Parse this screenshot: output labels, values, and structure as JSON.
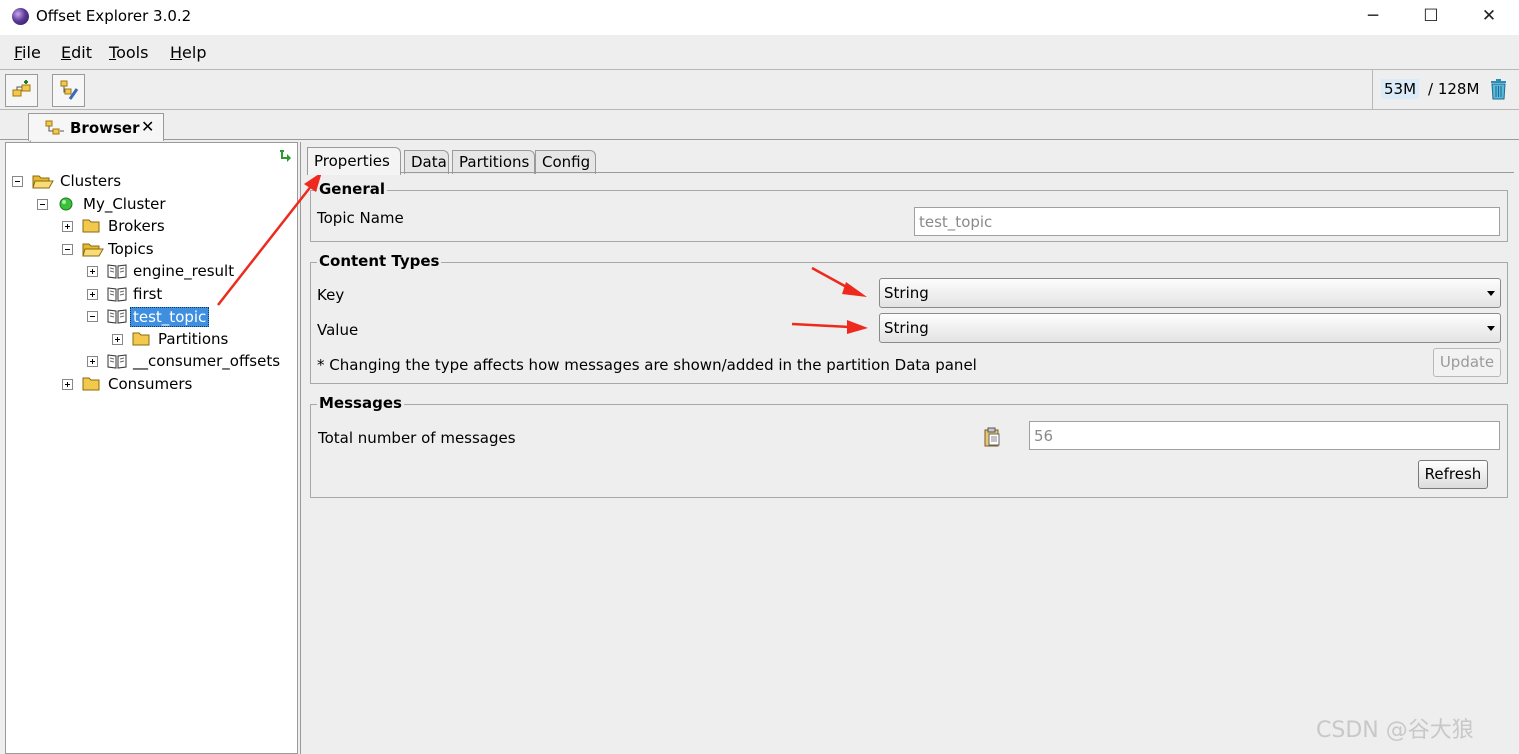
{
  "window": {
    "title": "Offset Explorer  3.0.2",
    "controls": {
      "minimize": "─",
      "maximize": "☐",
      "close": "✕"
    }
  },
  "menu": [
    {
      "label": "File",
      "mnemonic": "F",
      "rest": "ile"
    },
    {
      "label": "Edit",
      "mnemonic": "E",
      "rest": "dit"
    },
    {
      "label": "Tools",
      "mnemonic": "T",
      "rest": "ools"
    },
    {
      "label": "Help",
      "mnemonic": "H",
      "rest": "elp"
    }
  ],
  "toolbar": {
    "memory_used": "53M",
    "memory_total": " / 128M"
  },
  "browser_tab": {
    "label": "Browser",
    "close": "✕"
  },
  "tree": {
    "clusters": "Clusters",
    "cluster": "My_Cluster",
    "brokers": "Brokers",
    "topics": "Topics",
    "topic_items": [
      "engine_result",
      "first",
      "test_topic"
    ],
    "partitions": "Partitions",
    "consumer_offsets": "__consumer_offsets",
    "consumers": "Consumers"
  },
  "tabs": [
    "Properties",
    "Data",
    "Partitions",
    "Config"
  ],
  "general": {
    "title": "General",
    "topic_name_label": "Topic Name",
    "topic_name_value": "test_topic"
  },
  "content_types": {
    "title": "Content Types",
    "key_label": "Key",
    "key_value": "String",
    "value_label": "Value",
    "value_value": "String",
    "note": "* Changing the type affects how messages are shown/added in the partition Data panel",
    "update_button": "Update"
  },
  "messages": {
    "title": "Messages",
    "total_label": "Total number of messages",
    "total_value": "56",
    "refresh_button": "Refresh"
  },
  "watermark": "CSDN @谷大狼",
  "colors": {
    "selection": "#3e8fe0",
    "annotation_arrow": "#ee2a1e",
    "cluster_status": "#3cc03c",
    "folder": "#f2c94c",
    "trash": "#2a8fb8"
  }
}
